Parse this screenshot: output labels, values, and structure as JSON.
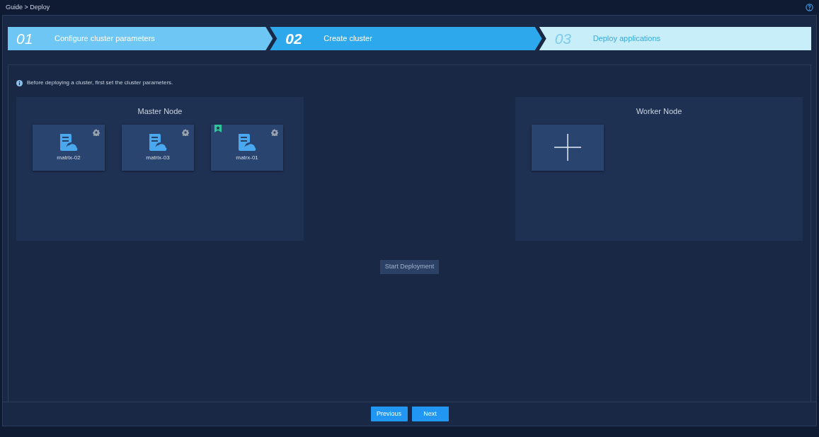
{
  "breadcrumb": "Guide > Deploy",
  "steps": [
    {
      "number": "01",
      "label": "Configure cluster parameters",
      "selected": false,
      "completed": true
    },
    {
      "number": "02",
      "label": "Create cluster",
      "selected": true,
      "completed": false
    },
    {
      "number": "03",
      "label": "Deploy applications",
      "selected": false,
      "completed": false
    }
  ],
  "info": "Before deploying a cluster, first set the cluster parameters.",
  "master_node": {
    "title": "Master Node",
    "nodes": [
      {
        "name": "matrix-02",
        "primary": false
      },
      {
        "name": "matrix-03",
        "primary": false
      },
      {
        "name": "matrx-01",
        "primary": true
      }
    ]
  },
  "worker_node": {
    "title": "Worker Node"
  },
  "start_button": {
    "label": "Start Deployment",
    "disabled": true
  },
  "footer_buttons": [
    "Previous",
    "Next"
  ]
}
